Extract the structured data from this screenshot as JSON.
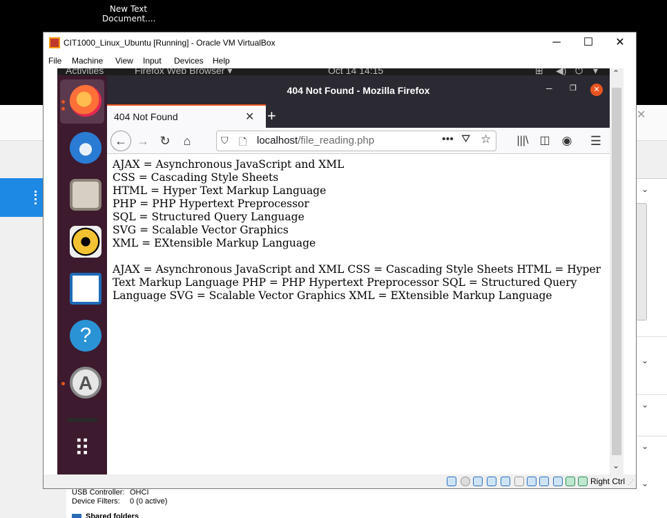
{
  "desktop": {
    "icon_label": "New Text Document...."
  },
  "vm_window": {
    "title": "CIT1000_Linux_Ubuntu [Running] - Oracle VM VirtualBox",
    "minimize": "─",
    "maximize": "☐",
    "close": "✕",
    "menus": [
      "File",
      "Machine",
      "View",
      "Input",
      "Devices",
      "Help"
    ],
    "host_key": "Right Ctrl"
  },
  "gnome": {
    "activities": "Activities",
    "app_menu": "Firefox Web Browser ▾",
    "clock": "Oct 14  14:15"
  },
  "dock": {
    "apps": [
      {
        "name": "firefox",
        "color": "#ff7139",
        "active": true
      },
      {
        "name": "thunderbird",
        "color": "#2a7bd4"
      },
      {
        "name": "files",
        "color": "#d7cfc4"
      },
      {
        "name": "rhythmbox",
        "color": "#f2c232"
      },
      {
        "name": "writer",
        "color": "#1e6bb8"
      },
      {
        "name": "help",
        "color": "#2a93d5"
      },
      {
        "name": "software",
        "color": "#e6e6e6",
        "running": true
      }
    ],
    "show_apps": "⠿"
  },
  "firefox": {
    "window_title": "404 Not Found - Mozilla Firefox",
    "tab_title": "404 Not Found",
    "url_host": "localhost",
    "url_path": "/file_reading.php"
  },
  "page": {
    "lines": [
      "AJAX = Asynchronous JavaScript and XML",
      "CSS = Cascading Style Sheets",
      "HTML = Hyper Text Markup Language",
      "PHP = PHP Hypertext Preprocessor",
      "SQL = Structured Query Language",
      "SVG = Scalable Vector Graphics",
      "XML = EXtensible Markup Language"
    ],
    "paragraph": "AJAX = Asynchronous JavaScript and XML CSS = Cascading Style Sheets HTML = Hyper Text Markup Language PHP = PHP Hypertext Preprocessor SQL = Structured Query Language SVG = Scalable Vector Graphics XML = EXtensible Markup Language"
  },
  "details": {
    "usb_label": "USB Controller:",
    "usb_value": "OHCI",
    "filters_label": "Device Filters:",
    "filters_value": "0 (0 active)",
    "shared_folders": "Shared folders"
  }
}
